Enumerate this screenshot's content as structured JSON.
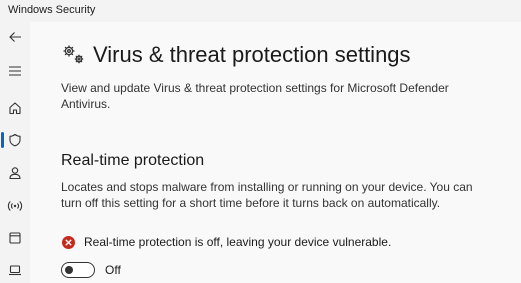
{
  "window": {
    "title": "Windows Security"
  },
  "nav": {
    "items": [
      {
        "icon": "back-arrow-icon"
      },
      {
        "icon": "hamburger-menu-icon"
      },
      {
        "icon": "home-icon"
      },
      {
        "icon": "shield-icon",
        "selected": true
      },
      {
        "icon": "person-icon"
      },
      {
        "icon": "wireless-antenna-icon"
      },
      {
        "icon": "app-browser-icon"
      },
      {
        "icon": "laptop-icon"
      }
    ],
    "accent_color": "#0a66b8"
  },
  "page": {
    "title": "Virus & threat protection settings",
    "description": "View and update Virus & threat protection settings for Microsoft Defender Antivirus."
  },
  "realtime": {
    "title": "Real-time protection",
    "description": "Locates and stops malware from installing or running on your device. You can turn off this setting for a short time before it turns back on automatically.",
    "warning": "Real-time protection is off, leaving your device vulnerable.",
    "warning_color": "#c42b1c",
    "toggle_label": "Off",
    "toggle_on": false
  }
}
